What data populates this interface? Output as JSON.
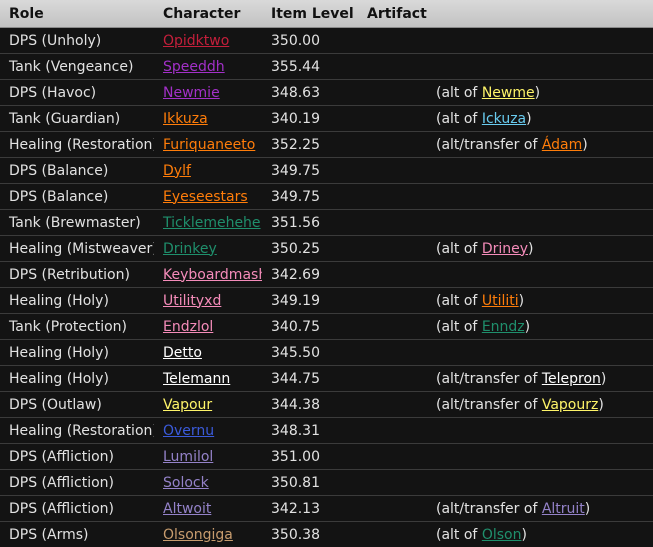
{
  "columns": [
    "Role",
    "Character",
    "Item Level",
    "Artifact",
    ""
  ],
  "rows": [
    {
      "role": "DPS (Unholy)",
      "character": "Opidktwo",
      "char_color": "#c41f3b",
      "ilvl": "350.00",
      "note": null
    },
    {
      "role": "Tank (Vengeance)",
      "character": "Speeddh",
      "char_color": "#a330c9",
      "ilvl": "355.44",
      "note": null
    },
    {
      "role": "DPS (Havoc)",
      "character": "Newmie",
      "char_color": "#a330c9",
      "ilvl": "348.63",
      "note": {
        "prefix": "(alt of ",
        "name": "Newme",
        "color": "#fff569",
        "suffix": ")"
      }
    },
    {
      "role": "Tank (Guardian)",
      "character": "Ikkuza",
      "char_color": "#ff7d0a",
      "ilvl": "340.19",
      "note": {
        "prefix": "(alt of ",
        "name": "Ickuza",
        "color": "#69ccf0",
        "suffix": ")"
      }
    },
    {
      "role": "Healing (Restoration)",
      "character": "Furiquaneeto",
      "char_color": "#ff7d0a",
      "ilvl": "352.25",
      "note": {
        "prefix": "(alt/transfer of ",
        "name": "Ádam",
        "color": "#ff7d0a",
        "suffix": ")"
      }
    },
    {
      "role": "DPS (Balance)",
      "character": "Dylf",
      "char_color": "#ff7d0a",
      "ilvl": "349.75",
      "note": null
    },
    {
      "role": "DPS (Balance)",
      "character": "Eyeseestars",
      "char_color": "#ff7d0a",
      "ilvl": "349.75",
      "note": null
    },
    {
      "role": "Tank (Brewmaster)",
      "character": "Ticklemehehe",
      "char_color": "#1f8f6c",
      "ilvl": "351.56",
      "note": null
    },
    {
      "role": "Healing (Mistweaver)",
      "character": "Drinkey",
      "char_color": "#1f8f6c",
      "ilvl": "350.25",
      "note": {
        "prefix": "(alt of ",
        "name": "Driney",
        "color": "#f58cba",
        "suffix": ")"
      }
    },
    {
      "role": "DPS (Retribution)",
      "character": "Keyboardmash",
      "char_color": "#f58cba",
      "ilvl": "342.69",
      "note": null
    },
    {
      "role": "Healing (Holy)",
      "character": "Utilityxd",
      "char_color": "#f58cba",
      "ilvl": "349.19",
      "note": {
        "prefix": "(alt of ",
        "name": "Utiliti",
        "color": "#ff7d0a",
        "suffix": ")"
      }
    },
    {
      "role": "Tank (Protection)",
      "character": "Endzlol",
      "char_color": "#f58cba",
      "ilvl": "340.75",
      "note": {
        "prefix": "(alt of ",
        "name": "Enndz",
        "color": "#1f8f6c",
        "suffix": ")"
      }
    },
    {
      "role": "Healing (Holy)",
      "character": "Detto",
      "char_color": "#ffffff",
      "ilvl": "345.50",
      "note": null
    },
    {
      "role": "Healing (Holy)",
      "character": "Telemann",
      "char_color": "#ffffff",
      "ilvl": "344.75",
      "note": {
        "prefix": "(alt/transfer of ",
        "name": "Telepron",
        "color": "#ffffff",
        "suffix": ")"
      }
    },
    {
      "role": "DPS (Outlaw)",
      "character": "Vapour",
      "char_color": "#fff569",
      "ilvl": "344.38",
      "note": {
        "prefix": "(alt/transfer of ",
        "name": "Vapourz",
        "color": "#fff569",
        "suffix": ")"
      }
    },
    {
      "role": "Healing (Restoration)",
      "character": "Overnu",
      "char_color": "#3b5bdb",
      "ilvl": "348.31",
      "note": null
    },
    {
      "role": "DPS (Affliction)",
      "character": "Lumilol",
      "char_color": "#9482c9",
      "ilvl": "351.00",
      "note": null
    },
    {
      "role": "DPS (Affliction)",
      "character": "Solock",
      "char_color": "#9482c9",
      "ilvl": "350.81",
      "note": null
    },
    {
      "role": "DPS (Affliction)",
      "character": "Altwoit",
      "char_color": "#9482c9",
      "ilvl": "342.13",
      "note": {
        "prefix": "(alt/transfer of ",
        "name": "Altruit",
        "color": "#9482c9",
        "suffix": ")"
      }
    },
    {
      "role": "DPS (Arms)",
      "character": "Olsongiga",
      "char_color": "#c79c6e",
      "ilvl": "350.38",
      "note": {
        "prefix": "(alt of ",
        "name": "Olson",
        "color": "#1f8f6c",
        "suffix": ")"
      }
    }
  ]
}
